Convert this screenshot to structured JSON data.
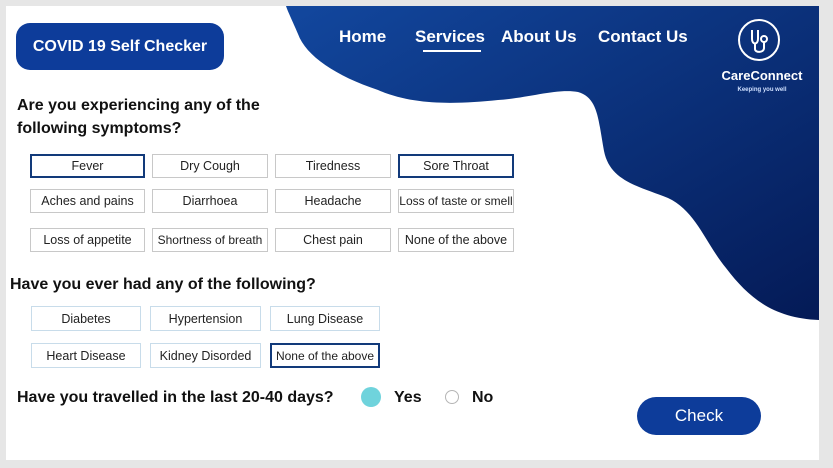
{
  "header": {
    "title": "COVID 19 Self Checker",
    "nav": [
      {
        "label": "Home"
      },
      {
        "label": "Services"
      },
      {
        "label": "About Us"
      },
      {
        "label": "Contact Us"
      }
    ],
    "active_nav": "Services",
    "brand_name": "CareConnect",
    "brand_tagline": "Keeping you well",
    "logo_icon": "stethoscope-icon",
    "accent_color": "#0d3c9a"
  },
  "symptoms": {
    "question": "Are you experiencing any of the following symptoms?",
    "options": [
      {
        "label": "Fever",
        "selected": true
      },
      {
        "label": "Dry Cough",
        "selected": false
      },
      {
        "label": "Tiredness",
        "selected": false
      },
      {
        "label": "Sore Throat",
        "selected": true
      },
      {
        "label": "Aches and pains",
        "selected": false
      },
      {
        "label": "Diarrhoea",
        "selected": false
      },
      {
        "label": "Headache",
        "selected": false
      },
      {
        "label": "Loss of taste or smell",
        "selected": false
      },
      {
        "label": "Loss of appetite",
        "selected": false
      },
      {
        "label": "Shortness of breath",
        "selected": false
      },
      {
        "label": "Chest pain",
        "selected": false
      },
      {
        "label": "None of the above",
        "selected": false
      }
    ]
  },
  "conditions": {
    "question": "Have you ever had any of the following?",
    "options": [
      {
        "label": "Diabetes",
        "selected": false
      },
      {
        "label": "Hypertension",
        "selected": false
      },
      {
        "label": "Lung Disease",
        "selected": false
      },
      {
        "label": "Heart Disease",
        "selected": false
      },
      {
        "label": "Kidney Disorded",
        "selected": false
      },
      {
        "label": "None of the above",
        "selected": true
      }
    ]
  },
  "travel": {
    "question": "Have you travelled in the last 20-40 days?",
    "yes_label": "Yes",
    "no_label": "No",
    "selected": "Yes"
  },
  "actions": {
    "check_label": "Check"
  }
}
